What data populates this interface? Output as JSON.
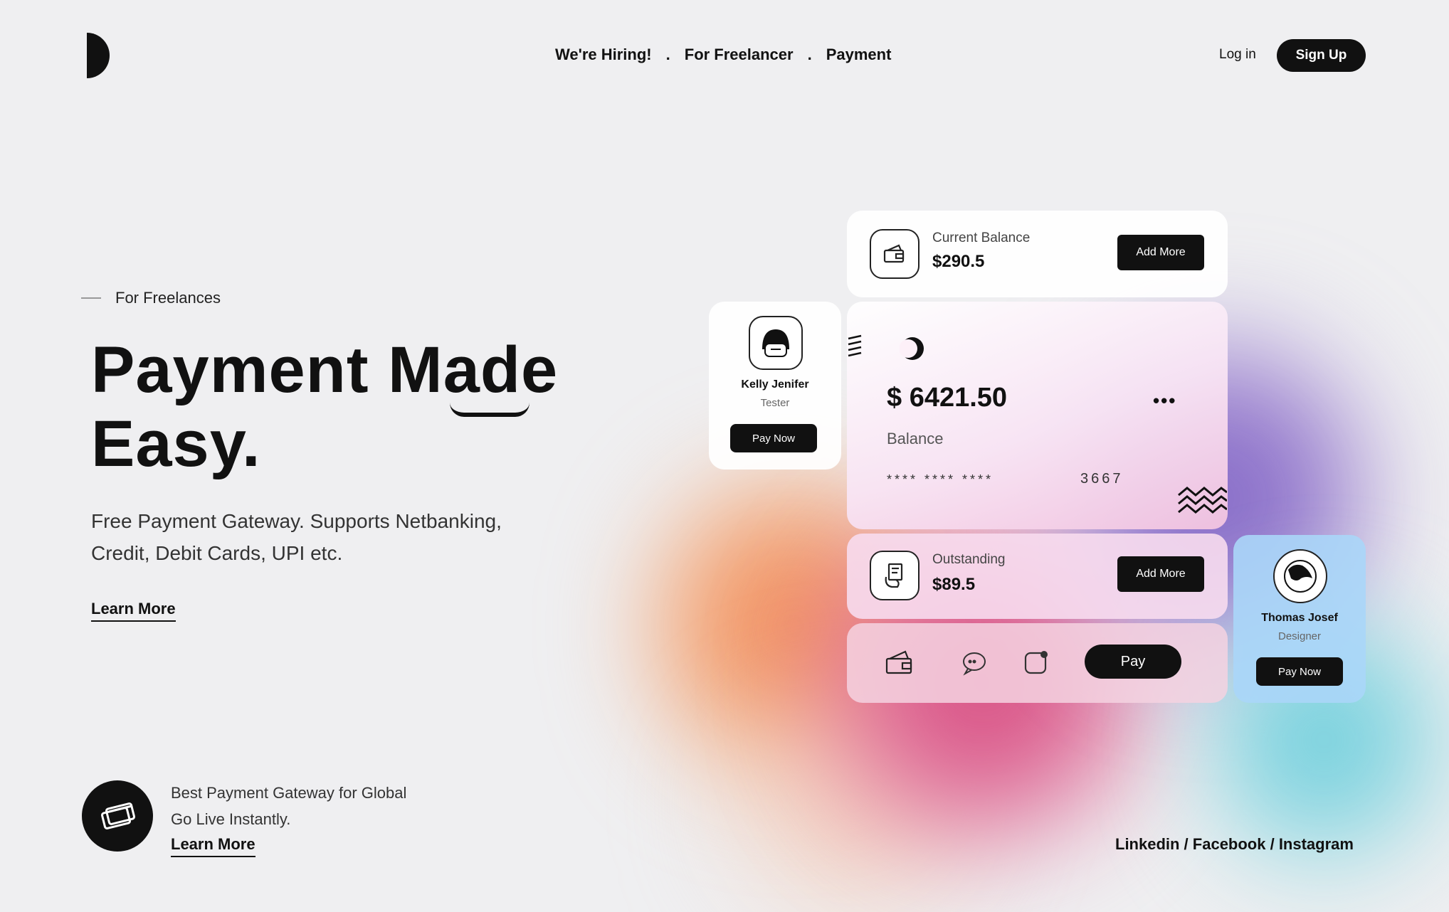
{
  "nav": {
    "items": [
      "We're Hiring!",
      "For Freelancer",
      "Payment"
    ],
    "separator": ".",
    "login": "Log in",
    "signup": "Sign Up"
  },
  "hero": {
    "kicker": "For Freelances",
    "headline_line1": "Payment Made",
    "headline_line2": "Easy.",
    "description": "Free Payment Gateway. Supports Netbanking, Credit, Debit Cards, UPI etc.",
    "learn_more": "Learn More"
  },
  "promo": {
    "line1": "Best Payment Gateway for Global",
    "line2": "Go Live Instantly.",
    "learn_more": "Learn More"
  },
  "social": {
    "text": "Linkedin  / Facebook / Instagram"
  },
  "cards": {
    "balance": {
      "label": "Current Balance",
      "amount": "$290.5",
      "button": "Add More"
    },
    "main": {
      "amount": "$ 6421.50",
      "label": "Balance",
      "masked": "****  ****  ****",
      "last4": "3667",
      "more": "•••"
    },
    "outstanding": {
      "label": "Outstanding",
      "amount": "$89.5",
      "button": "Add More"
    },
    "bar": {
      "pay": "Pay"
    },
    "kelly": {
      "name": "Kelly Jenifer",
      "role": "Tester",
      "button": "Pay Now"
    },
    "thomas": {
      "name": "Thomas Josef",
      "role": "Designer",
      "button": "Pay Now"
    }
  },
  "colors": {
    "accent": "#111111",
    "background": "#efeff1"
  }
}
